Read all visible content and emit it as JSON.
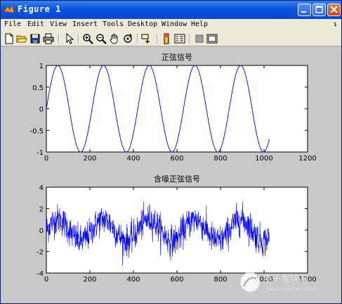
{
  "window": {
    "title": "Figure 1"
  },
  "menu": [
    "File",
    "Edit",
    "View",
    "Insert",
    "Tools",
    "Desktop",
    "Window",
    "Help"
  ],
  "toolbar": [
    "new-figure",
    "open-file",
    "save",
    "print",
    "pointer",
    "zoom-in",
    "zoom-out",
    "pan",
    "rotate-3d",
    "data-cursor",
    "colorbar",
    "legend",
    "hide-plot-tools",
    "show-plot-tools"
  ],
  "chart_data": [
    {
      "type": "line",
      "title": "正弦信号",
      "x_ticks": [
        "0",
        "200",
        "400",
        "600",
        "800",
        "1000",
        "1200"
      ],
      "y_ticks": [
        "1",
        "0.5",
        "0",
        "-0.5",
        "-1"
      ],
      "xlim": [
        0,
        1200
      ],
      "ylim": [
        -1,
        1
      ],
      "series": [
        {
          "amplitude": 1,
          "period": 210,
          "phase": 0,
          "x_start": 0,
          "x_end": 1024,
          "noise_std": 0
        }
      ],
      "color": "#0000ff"
    },
    {
      "type": "line",
      "title": "含噪正弦信号",
      "x_ticks": [
        "0",
        "200",
        "400",
        "600",
        "800",
        "1000",
        "1200"
      ],
      "y_ticks": [
        "4",
        "2",
        "0",
        "-2",
        "-4"
      ],
      "xlim": [
        0,
        1200
      ],
      "ylim": [
        -4,
        4
      ],
      "series": [
        {
          "amplitude": 1,
          "period": 210,
          "phase": 0,
          "x_start": 0,
          "x_end": 1024,
          "noise_std": 0.7
        }
      ],
      "color": "#0000ff"
    }
  ],
  "watermark": {
    "line1": "电子发烧友",
    "line2": "www.elecfans.com"
  }
}
